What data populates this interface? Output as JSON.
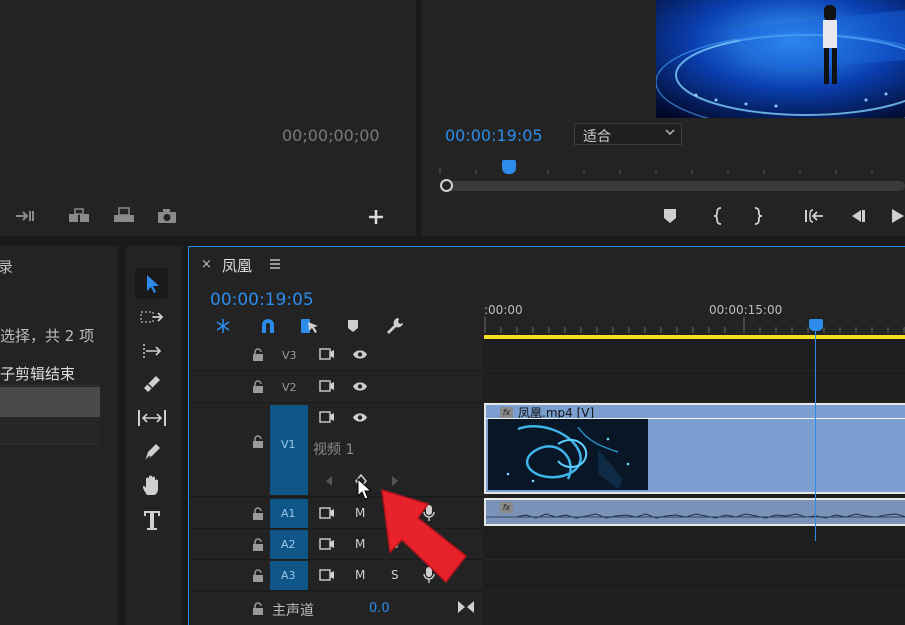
{
  "source_monitor": {
    "timecode": "00;00;00;00"
  },
  "program_monitor": {
    "timecode": "00:00:19:05",
    "zoom_select": "适合"
  },
  "project_panel": {
    "title_fragment": "录",
    "selection_status": "选择，共 2 项",
    "item_label": "子剪辑结束"
  },
  "sequence": {
    "tab_name": "凤凰",
    "timecode": "00:00:19:05",
    "ruler_labels": [
      ":00:00",
      "00:00:15:00"
    ],
    "playhead_fraction": 0.815
  },
  "tracks": {
    "video": [
      {
        "label": "V3"
      },
      {
        "label": "V2"
      },
      {
        "label": "V1",
        "name": "视频 1"
      }
    ],
    "audio": [
      {
        "label": "A1",
        "mute": "M",
        "solo": "S"
      },
      {
        "label": "A2",
        "mute": "M",
        "solo": "S"
      },
      {
        "label": "A3",
        "mute": "M",
        "solo": "S"
      }
    ],
    "master": {
      "label": "主声道",
      "value": "0.0"
    }
  },
  "clips": {
    "video_clip_label": "凤凰.mp4 [V]",
    "fx_badge": "fx"
  },
  "colors": {
    "accent_blue": "#2d8ceb",
    "clip_video": "#7a9fd0",
    "clip_audio": "#7b93b8",
    "track_target": "#0f5688",
    "work_area": "#f3e120",
    "cursor_arrow": "#e8222b"
  }
}
